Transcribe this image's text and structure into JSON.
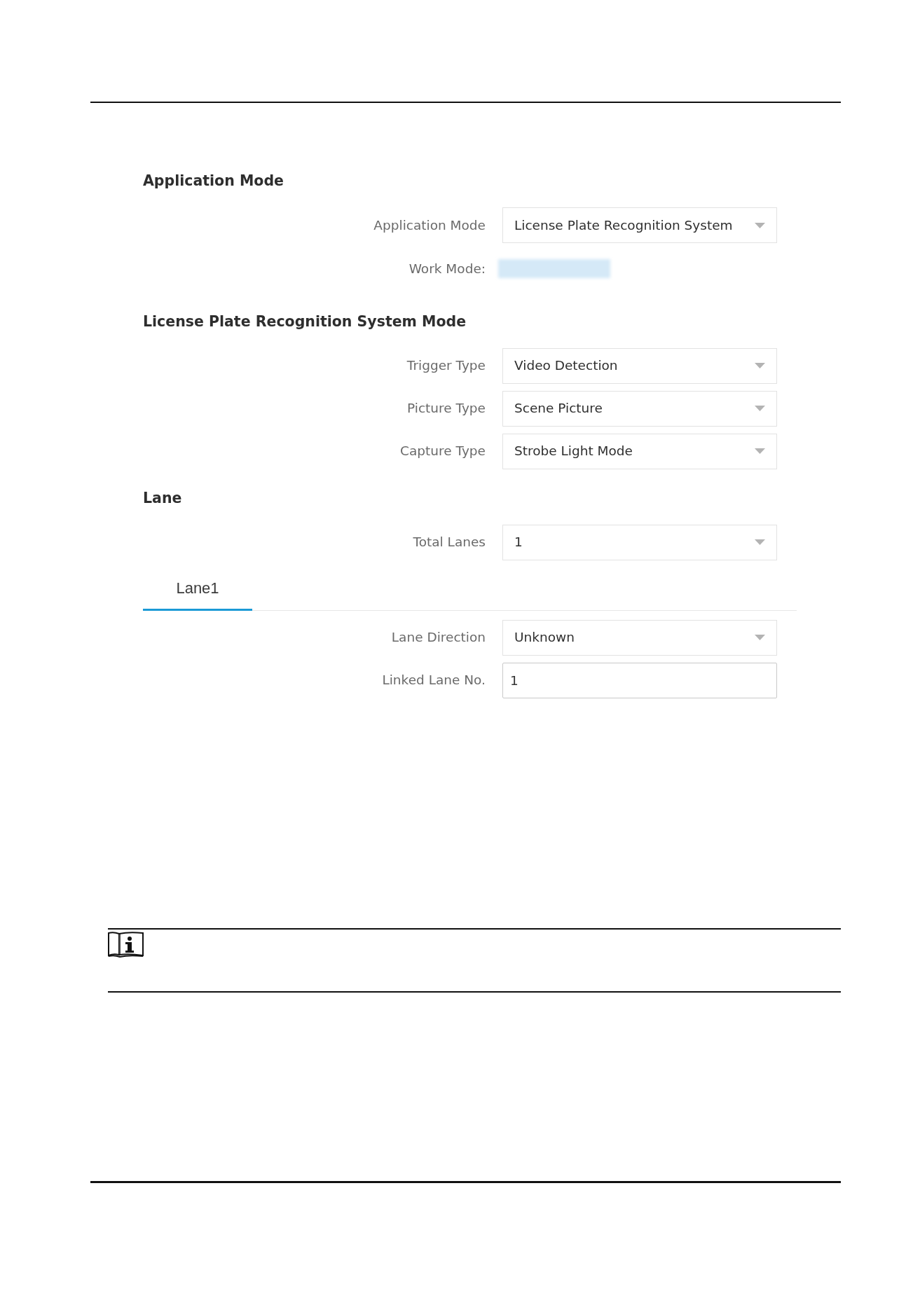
{
  "sections": [
    {
      "heading": "Application Mode",
      "fields": [
        {
          "kind": "select",
          "label": "Application Mode",
          "value": "License Plate Recognition System"
        },
        {
          "kind": "blurred",
          "label": "Work Mode:"
        }
      ]
    },
    {
      "heading": "License Plate Recognition System Mode",
      "fields": [
        {
          "kind": "select",
          "label": "Trigger Type",
          "value": "Video Detection"
        },
        {
          "kind": "select",
          "label": "Picture Type",
          "value": "Scene Picture"
        },
        {
          "kind": "select",
          "label": "Capture Type",
          "value": "Strobe Light Mode"
        }
      ]
    },
    {
      "heading": "Lane",
      "fields": [
        {
          "kind": "select",
          "label": "Total Lanes",
          "value": "1"
        }
      ],
      "tabs": [
        {
          "label": "Lane1",
          "selected": true
        }
      ],
      "tab_fields": [
        {
          "kind": "select",
          "label": "Lane Direction",
          "value": "Unknown"
        },
        {
          "kind": "input",
          "label": "Linked Lane No.",
          "value": "1"
        }
      ]
    }
  ]
}
